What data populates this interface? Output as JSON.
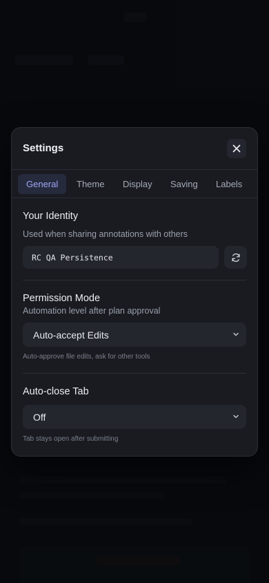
{
  "modal": {
    "title": "Settings",
    "tabs": [
      {
        "label": "General",
        "active": true
      },
      {
        "label": "Theme",
        "active": false
      },
      {
        "label": "Display",
        "active": false
      },
      {
        "label": "Saving",
        "active": false
      },
      {
        "label": "Labels",
        "active": false
      }
    ],
    "identity": {
      "title": "Your Identity",
      "description": "Used when sharing annotations with others",
      "value": "RC QA Persistence"
    },
    "permission_mode": {
      "title": "Permission Mode",
      "description": "Automation level after plan approval",
      "selected": "Auto-accept Edits",
      "hint": "Auto-approve file edits, ask for other tools"
    },
    "auto_close_tab": {
      "title": "Auto-close Tab",
      "selected": "Off",
      "hint": "Tab stays open after submitting"
    }
  },
  "icons": {
    "close": "close-icon",
    "regenerate": "refresh-icon",
    "dropdown": "chevron-down-icon"
  },
  "colors": {
    "modal_bg": "#191b21",
    "active_tab_bg": "#262a3d",
    "active_tab_text": "#9fa8f5",
    "field_bg": "#23262d"
  }
}
